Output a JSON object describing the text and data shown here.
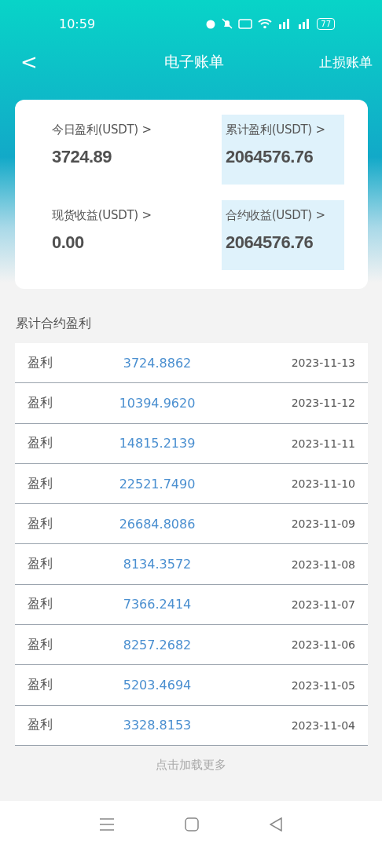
{
  "status_bar": {
    "time": "10:59",
    "battery": "77"
  },
  "header": {
    "back": "<",
    "title": "电子账单",
    "action": "止损账单"
  },
  "summary": [
    {
      "label": "今日盈利(USDT)",
      "arrow": ">",
      "value": "3724.89",
      "highlighted": false
    },
    {
      "label": "累计盈利(USDT)",
      "arrow": ">",
      "value": "2064576.76",
      "highlighted": true
    },
    {
      "label": "现货收益(USDT)",
      "arrow": ">",
      "value": "0.00",
      "highlighted": false
    },
    {
      "label": "合约收益(USDT)",
      "arrow": ">",
      "value": "2064576.76",
      "highlighted": true
    }
  ],
  "section_title": "累计合约盈利",
  "rows": [
    {
      "type": "盈利",
      "amount": "3724.8862",
      "date": "2023-11-13"
    },
    {
      "type": "盈利",
      "amount": "10394.9620",
      "date": "2023-11-12"
    },
    {
      "type": "盈利",
      "amount": "14815.2139",
      "date": "2023-11-11"
    },
    {
      "type": "盈利",
      "amount": "22521.7490",
      "date": "2023-11-10"
    },
    {
      "type": "盈利",
      "amount": "26684.8086",
      "date": "2023-11-09"
    },
    {
      "type": "盈利",
      "amount": "8134.3572",
      "date": "2023-11-08"
    },
    {
      "type": "盈利",
      "amount": "7366.2414",
      "date": "2023-11-07"
    },
    {
      "type": "盈利",
      "amount": "8257.2682",
      "date": "2023-11-06"
    },
    {
      "type": "盈利",
      "amount": "5203.4694",
      "date": "2023-11-05"
    },
    {
      "type": "盈利",
      "amount": "3328.8153",
      "date": "2023-11-04"
    }
  ],
  "load_more": "点击加载更多"
}
